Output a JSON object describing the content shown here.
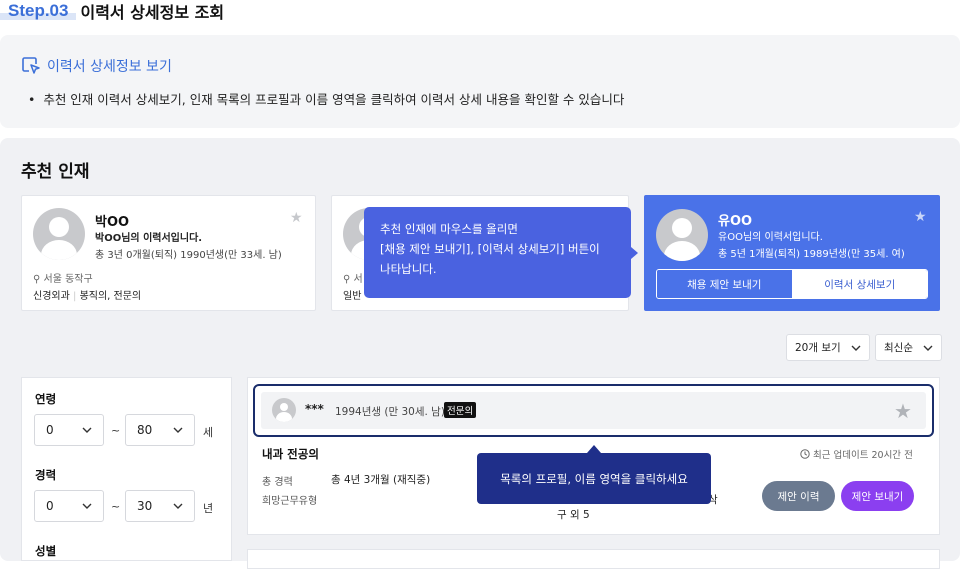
{
  "header": {
    "step": "Step.03",
    "title": "이력서 상세정보 조회"
  },
  "info": {
    "head": "이력서 상세정보 보기",
    "bullet": "추천 인재 이력서 상세보기, 인재 목록의 프로필과 이름 영역을 클릭하여 이력서 상세 내용을 확인할 수 있습니다"
  },
  "section_title": "추천 인재",
  "cards": [
    {
      "name": "박OO",
      "subtitle": "박OO님의 이력서입니다.",
      "detail": "총 3년 0개월(퇴직) 1990년생(만 33세. 남)",
      "location": "서울 동작구",
      "tag1": "신경외과",
      "tag2": "봉직의, 전문의"
    },
    {
      "name": "",
      "subtitle": "",
      "detail": "",
      "location": "서",
      "tag1": "일반",
      "tag2": ""
    },
    {
      "name": "유OO",
      "subtitle": "유OO님의 이력서입니다.",
      "detail": "총 5년 1개월(퇴직) 1989년생(만 35세. 여)",
      "offer_btn": "채용 제안 보내기",
      "view_btn": "이력서 상세보기"
    }
  ],
  "tooltip1": {
    "line1": "추천 인재에 마우스를 올리면",
    "line2": "[채용 제안 보내기], [이력서 상세보기] 버튼이",
    "line3": "나타납니다."
  },
  "controls": {
    "per_page": "20개 보기",
    "sort": "최신순"
  },
  "filter": {
    "age_label": "연령",
    "age_min": "0",
    "age_max": "80",
    "age_unit": "세",
    "career_label": "경력",
    "career_min": "0",
    "career_max": "30",
    "career_unit": "년",
    "gender_label": "성별",
    "tilde": "~"
  },
  "result": {
    "name": "***",
    "birth": "1994년생 (만 30세. 남)",
    "badge": "전문의",
    "specialty": "내과 전공의",
    "updated": "최근 업데이트 20시간 전",
    "career_label": "총 경력",
    "career_value": "총 4년 3개월 (재직중)",
    "wish_label": "희망근무유형",
    "region_tail": "구 외 5",
    "type_tail": "삭",
    "offer_history_btn": "제안 이력",
    "send_offer_btn": "제안 보내기"
  },
  "tooltip2": "목록의 프로필, 이름 영역을 클릭하세요",
  "colors": {
    "accent": "#4a72e8",
    "navy": "#1f2f8a",
    "purple": "#8b3ff0",
    "gray_btn": "#6b7a90"
  }
}
